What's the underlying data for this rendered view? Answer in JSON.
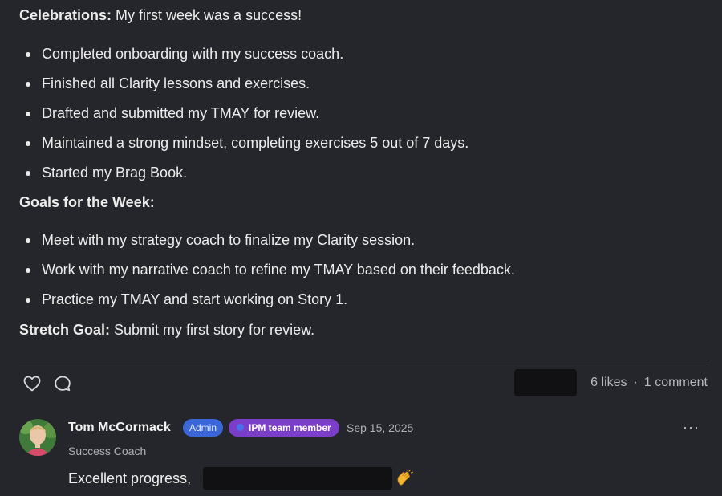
{
  "post": {
    "celebrations_label": "Celebrations:",
    "celebrations_text": " My first week was a success!",
    "celebrations": [
      "Completed onboarding with my success coach.",
      "Finished all Clarity lessons and exercises.",
      "Drafted and submitted my TMAY for review.",
      "Maintained a strong mindset, completing exercises 5 out of 7 days.",
      "Started my Brag Book."
    ],
    "goals_heading": "Goals for the Week:",
    "goals": [
      "Meet with my strategy coach to finalize my Clarity session.",
      "Work with my narrative coach to refine my TMAY based on their feedback.",
      "Practice my TMAY and start working on Story 1."
    ],
    "stretch_label": "Stretch Goal:",
    "stretch_text": " Submit my first story for review."
  },
  "actions": {
    "like_icon": "heart-icon",
    "comment_icon": "comment-bubble-icon",
    "likes_text": "6 likes",
    "separator": "·",
    "comments_text": "1 comment"
  },
  "comment": {
    "author": "Tom McCormack",
    "badge_admin": "Admin",
    "badge_team": "IPM team member",
    "date": "Sep 15, 2025",
    "more_icon": "more-options-icon",
    "more_label": "···",
    "role": "Success Coach",
    "text": "Excellent progress,",
    "emoji_icon": "clapping-hands-icon"
  },
  "colors": {
    "background": "#25262b",
    "admin_badge": "#3b66d8",
    "team_badge": "#7a3ec8"
  }
}
